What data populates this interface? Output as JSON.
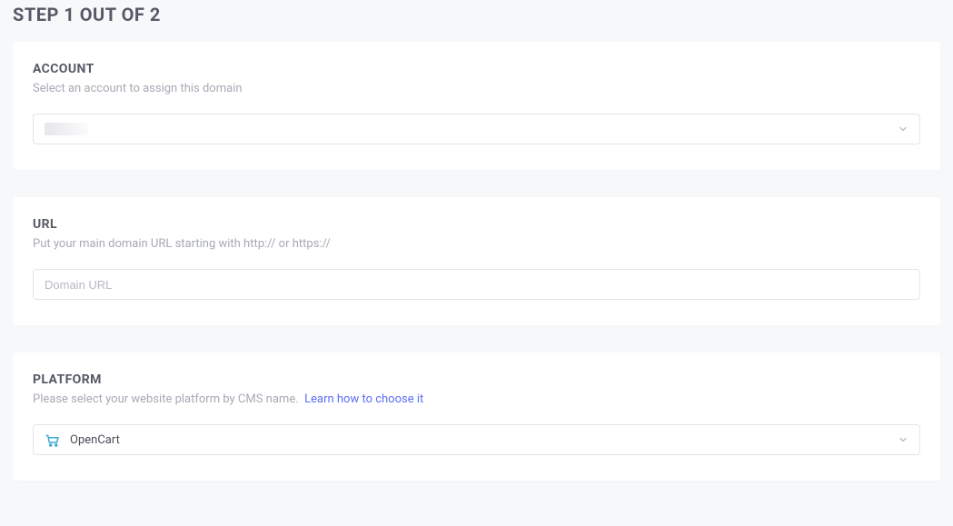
{
  "step": {
    "title": "STEP 1 OUT OF 2"
  },
  "account": {
    "title": "ACCOUNT",
    "description": "Select an account to assign this domain",
    "selected": ""
  },
  "url": {
    "title": "URL",
    "description": "Put your main domain URL starting with http:// or https://",
    "placeholder": "Domain URL",
    "value": ""
  },
  "platform": {
    "title": "PLATFORM",
    "description": "Please select your website platform by CMS name.",
    "learn_link": "Learn how to choose it",
    "selected": "OpenCart"
  }
}
